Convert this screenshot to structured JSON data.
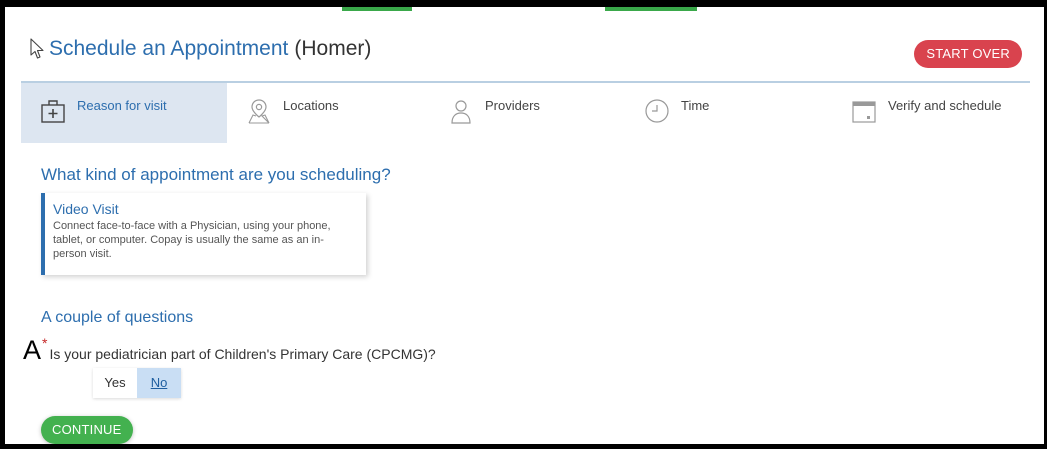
{
  "header": {
    "title": "Schedule an Appointment",
    "patient": "(Homer)",
    "start_over_label": "START OVER"
  },
  "steps": [
    {
      "label": "Reason for visit",
      "icon": "first-aid-kit-icon",
      "active": true
    },
    {
      "label": "Locations",
      "icon": "map-pin-icon",
      "active": false
    },
    {
      "label": "Providers",
      "icon": "person-icon",
      "active": false
    },
    {
      "label": "Time",
      "icon": "clock-icon",
      "active": false
    },
    {
      "label": "Verify and schedule",
      "icon": "calendar-icon",
      "active": false
    }
  ],
  "main": {
    "question": "What kind of appointment are you scheduling?",
    "visit_type": {
      "title": "Video Visit",
      "description": "Connect face-to-face with a Physician, using your phone, tablet, or computer. Copay is usually the same as an in-person visit."
    },
    "section_title": "A couple of questions",
    "annotation_letter": "A",
    "required_marker": "*",
    "question_text": "Is your pediatrician part of Children's Primary Care (CPCMG)?",
    "answer_yes": "Yes",
    "answer_no": "No",
    "selected_answer": "No",
    "continue_label": "CONTINUE"
  },
  "colors": {
    "accent": "#2d6eae",
    "danger": "#d9434e",
    "success": "#43b14f",
    "active_step_bg": "#dde6f1"
  }
}
